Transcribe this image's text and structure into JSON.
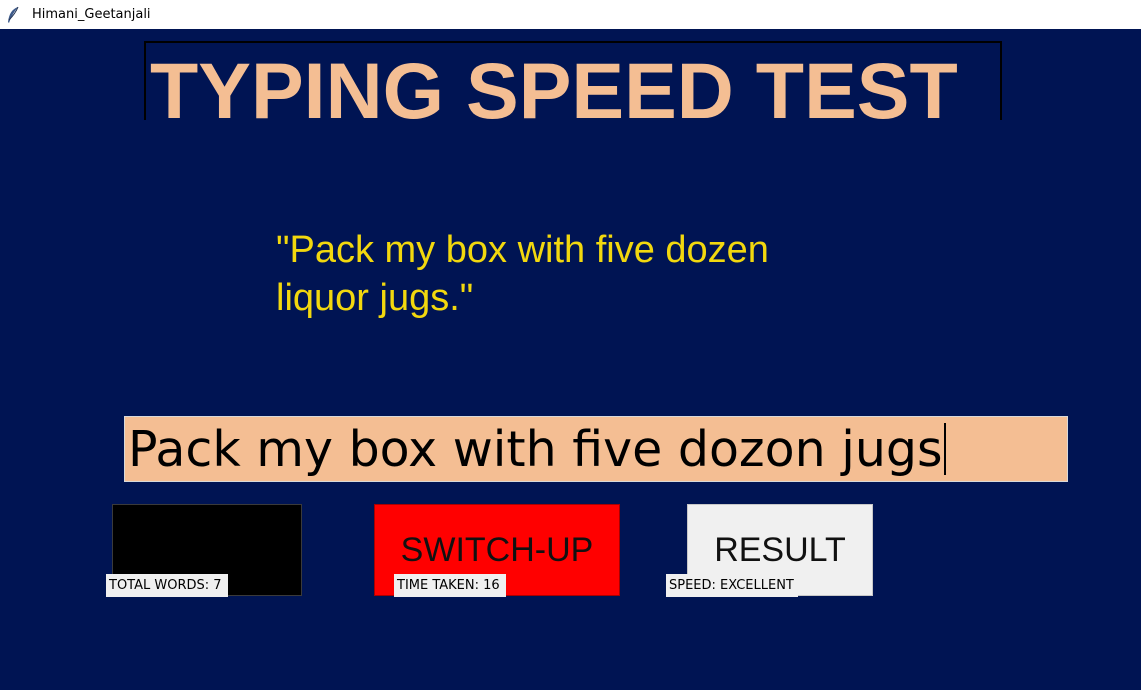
{
  "window": {
    "title": "Himani_Geetanjali",
    "icon": "feather-icon"
  },
  "heading": "TYPING SPEED TEST",
  "sentence": "\"Pack my box with five dozen liquor jugs.\"",
  "typing_input": {
    "value": "Pack my box with five dozon jugs"
  },
  "buttons": {
    "switch_label": "SWITCH-UP",
    "result_label": "RESULT"
  },
  "stats": {
    "total_words": "TOTAL WORDS: 7",
    "time_taken": "TIME TAKEN: 16",
    "speed": "SPEED: EXCELLENT"
  },
  "colors": {
    "background": "#001453",
    "heading": "#f4be93",
    "sentence": "#f2d80e",
    "input_background": "#f4be93",
    "switch_button": "#ff0000",
    "result_button": "#f0f0f0"
  }
}
